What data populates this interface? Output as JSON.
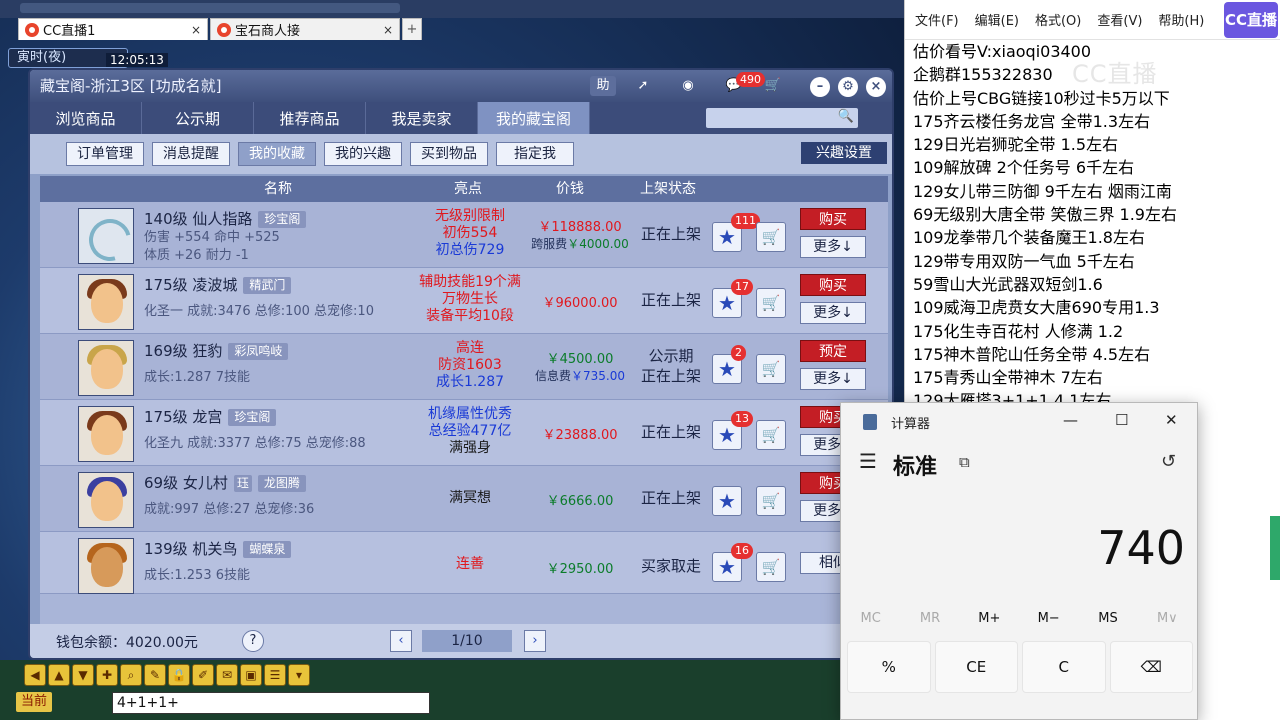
{
  "browser": {
    "tabs": [
      {
        "label": "CC直播1",
        "close": "×"
      },
      {
        "label": "宝石商人接",
        "close": "×"
      }
    ],
    "new_tab": "+"
  },
  "game": {
    "time_label": "寅时(夜)",
    "clock": "12:05:13",
    "now_label": "当前",
    "chat_input": "4+1+1+"
  },
  "dialog": {
    "title": "藏宝阁-浙江3区 [功成名就]",
    "help_label": "助",
    "cart_badge": "490",
    "nav_tabs": [
      "浏览商品",
      "公示期",
      "推荐商品",
      "我是卖家",
      "我的藏宝阁"
    ],
    "active_nav": 4,
    "sub_buttons": [
      "订单管理",
      "消息提醒",
      "我的收藏",
      "我的兴趣",
      "买到物品",
      "指定我"
    ],
    "interest_settings": "兴趣设置",
    "columns": {
      "name": "名称",
      "highlight": "亮点",
      "price": "价钱",
      "status": "上架状态"
    },
    "rows": [
      {
        "name": "140级  仙人指路",
        "tag": "珍宝阁",
        "info1": "伤害 +554 命中 +525",
        "info2": "体质 +26 耐力 -1",
        "hl": [
          "无级别限制",
          "初伤554",
          "初总伤729"
        ],
        "price": "￥118888.00",
        "fee_label": "跨服费",
        "fee": "￥4000.00",
        "status": [
          "正在上架"
        ],
        "fav": "111",
        "buy": "购买",
        "more": "更多↓"
      },
      {
        "name": "175级  凌波城",
        "tag": "精武门",
        "info1": "化圣一  成就:3476  总修:100  总宠修:10",
        "info2": "",
        "hl": [
          "辅助技能19个满",
          "万物生长",
          "装备平均10段"
        ],
        "price": "￥96000.00",
        "fee_label": "",
        "fee": "",
        "status": [
          "正在上架"
        ],
        "fav": "17",
        "buy": "购买",
        "more": "更多↓"
      },
      {
        "name": "169级  狂豹",
        "tag": "彩凤鸣岐",
        "info1": "成长:1.287  7技能",
        "info2": "",
        "hl": [
          "高连",
          "防资1603",
          "成长1.287"
        ],
        "price": "￥4500.00",
        "fee_label": "信息费",
        "fee": "￥735.00",
        "status": [
          "公示期",
          "正在上架"
        ],
        "fav": "2",
        "buy": "预定",
        "more": "更多↓"
      },
      {
        "name": "175级  龙宫",
        "tag": "珍宝阁",
        "info1": "化圣九  成就:3377  总修:75  总宠修:88",
        "info2": "",
        "hl": [
          "机缘属性优秀",
          "总经验477亿",
          "满强身"
        ],
        "price": "￥23888.00",
        "fee_label": "",
        "fee": "",
        "status": [
          "正在上架"
        ],
        "fav": "13",
        "buy": "购买",
        "more": "更多↓"
      },
      {
        "name": "69级  女儿村",
        "tag": "龙图腾",
        "tag2": "珏",
        "info1": "成就:997  总修:27  总宠修:36",
        "info2": "",
        "hl": [
          "满冥想"
        ],
        "price": "￥6666.00",
        "fee_label": "",
        "fee": "",
        "status": [
          "正在上架"
        ],
        "fav": "",
        "buy": "购买",
        "more": "更多↓"
      },
      {
        "name": "139级  机关鸟",
        "tag": "蝴蝶泉",
        "info1": "成长:1.253  6技能",
        "info2": "",
        "hl": [
          "连善"
        ],
        "price": "￥2950.00",
        "fee_label": "",
        "fee": "",
        "status": [
          "买家取走"
        ],
        "fav": "16",
        "buy": "",
        "more": "相似"
      }
    ],
    "wallet": "钱包余额：4020.00元",
    "page": "1/10"
  },
  "notepad": {
    "menu": [
      "文件(F)",
      "编辑(E)",
      "格式(O)",
      "查看(V)",
      "帮助(H)"
    ],
    "lines": [
      "估价看号V:xiaoqi03400",
      "企鹅群155322830",
      "估价上号CBG链接10秒过卡5万以下",
      "175齐云楼任务龙宫  全带1.3左右",
      "129日光岩狮驼全带  1.5左右",
      "109解放碑 2个任务号 6千左右",
      "129女儿带三防御 9千左右 烟雨江南",
      "69无级别大唐全带  笑傲三界 1.9左右",
      "109龙拳带几个装备魔王1.8左右",
      "129带专用双防一气血 5千左右",
      "59雪山大光武器双短剑1.6",
      "109威海卫虎贲女大唐690专用1.3",
      "175化生寺百花村 人修满 1.2",
      "175神木普陀山任务全带 4.5左右",
      "175青秀山全带神木  7左右",
      "129大雁塔3+1+1  4.1左右"
    ],
    "cc_logo": "CC直播",
    "watermark": "CC直播"
  },
  "calculator": {
    "title": "计算器",
    "mode": "标准",
    "display": "740",
    "memory": [
      "MC",
      "MR",
      "M+",
      "M−",
      "MS",
      "M∨"
    ],
    "keys": [
      "%",
      "CE",
      "C",
      "⌫"
    ]
  }
}
